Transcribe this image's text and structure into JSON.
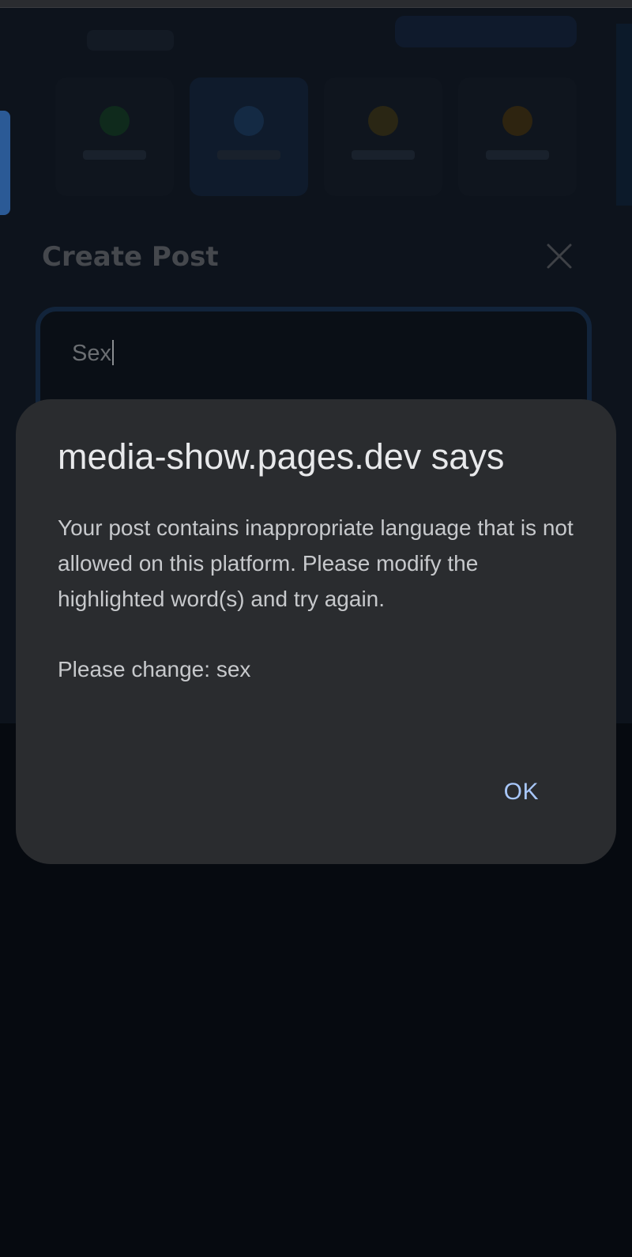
{
  "background_app": {
    "modal_title": "Create Post",
    "post_input_value": "Sex"
  },
  "dialog": {
    "title": "media-show.pages.dev says",
    "message": "Your post contains inappropriate language that is not allowed on this platform. Please modify the highlighted word(s) and try again.",
    "change_prompt": "Please change: sex",
    "ok_label": "OK"
  },
  "icons": {
    "close": "close-icon"
  },
  "colors": {
    "dialog_bg": "#2a2c2f",
    "ok_accent": "#a8c7fa",
    "page_bg": "#060a10"
  }
}
